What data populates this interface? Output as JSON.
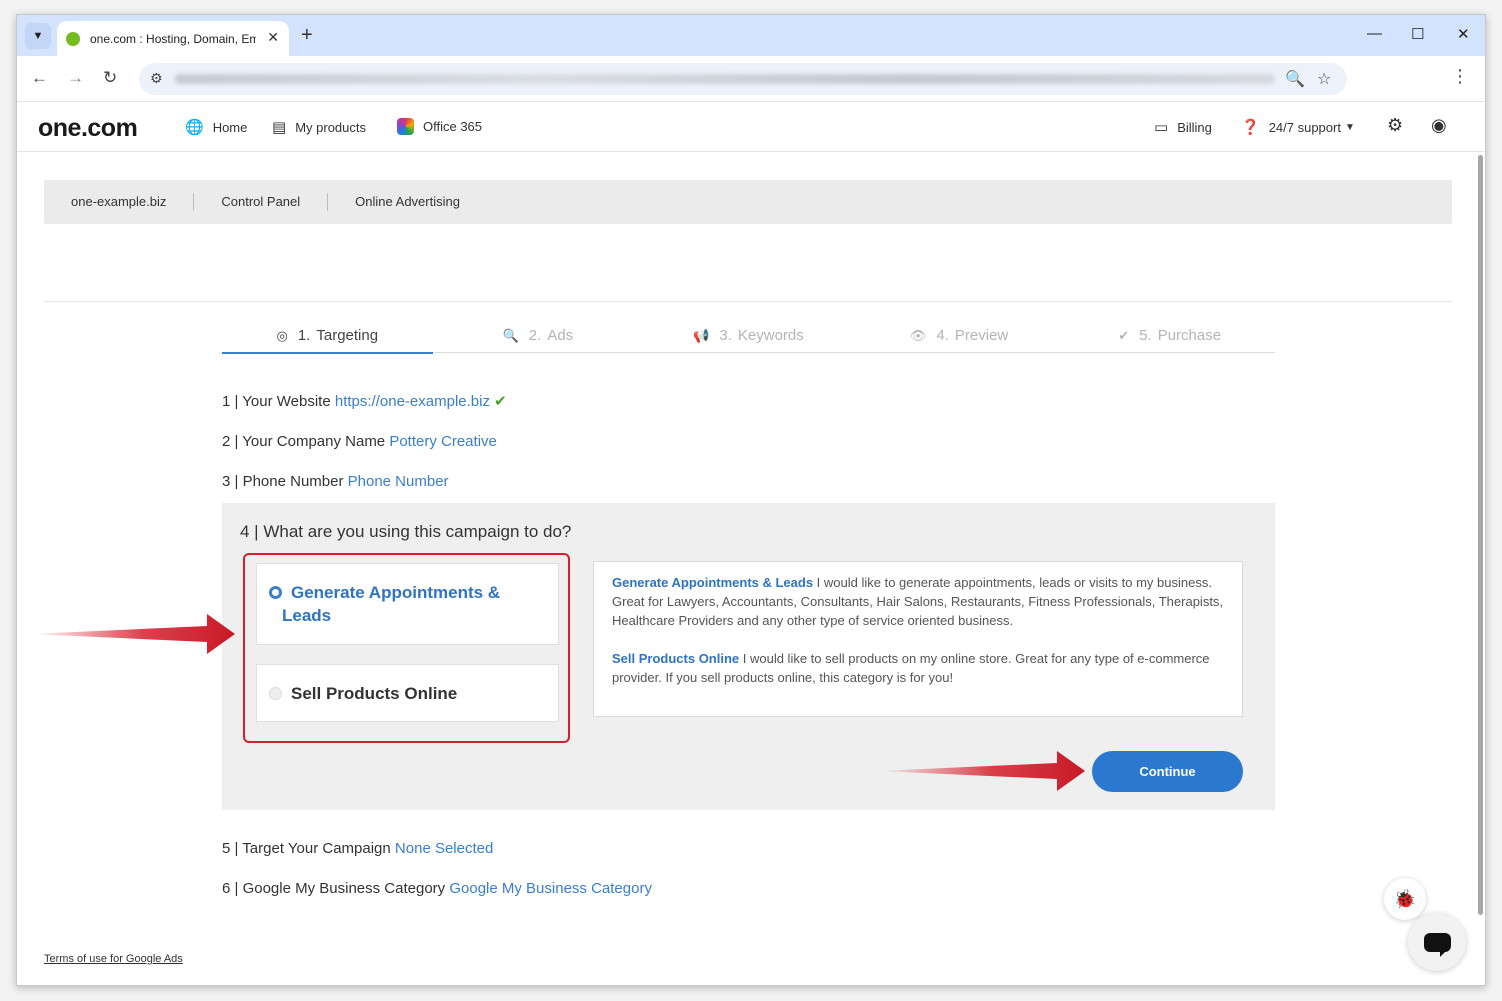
{
  "browser": {
    "tab_title": "one.com : Hosting, Domain, Email",
    "tab_close": "✕",
    "new_tab": "+",
    "minimize": "—",
    "maximize": "☐",
    "close": "✕"
  },
  "header": {
    "logo": "one.com",
    "nav": {
      "home": "Home",
      "my_products": "My products",
      "office365": "Office 365"
    },
    "billing": "Billing",
    "support": "24/7 support"
  },
  "breadcrumbs": [
    "one-example.biz",
    "Control Panel",
    "Online Advertising"
  ],
  "steps": [
    {
      "num": "1.",
      "label": "Targeting",
      "icon": "◎"
    },
    {
      "num": "2.",
      "label": "Ads",
      "icon": "🔍"
    },
    {
      "num": "3.",
      "label": "Keywords",
      "icon": "📢"
    },
    {
      "num": "4.",
      "label": "Preview",
      "icon": "👁"
    },
    {
      "num": "5.",
      "label": "Purchase",
      "icon": "✔"
    }
  ],
  "form": {
    "website_label": "1 | Your Website",
    "website_value": "https://one-example.biz",
    "company_label": "2 | Your Company Name",
    "company_value": "Pottery Creative",
    "phone_label": "3 | Phone Number",
    "phone_value": "Phone Number",
    "question": "4 | What are you using this campaign to do?",
    "option1_line1": "Generate Appointments &",
    "option1_line2": "Leads",
    "option2": "Sell Products Online",
    "desc1_title": "Generate Appointments & Leads",
    "desc1_text": " I would like to generate appointments, leads or visits to my business. Great for Lawyers, Accountants, Consultants, Hair Salons, Restaurants, Fitness Professionals, Therapists, Healthcare Providers and any other type of service oriented business.",
    "desc2_title": "Sell Products Online",
    "desc2_text": " I would like to sell products on my online store. Great for any type of e-commerce provider. If you sell products online, this category is for you!",
    "continue": "Continue",
    "target_label": "5 | Target Your Campaign",
    "target_value": "None Selected",
    "gmb_label": "6 | Google My Business Category",
    "gmb_value": "Google My Business Category"
  },
  "footer": {
    "terms": "Terms of use for Google Ads"
  },
  "colors": {
    "accent": "#2b78cf",
    "highlight": "#d51f2c",
    "check": "#4a9e2b"
  }
}
